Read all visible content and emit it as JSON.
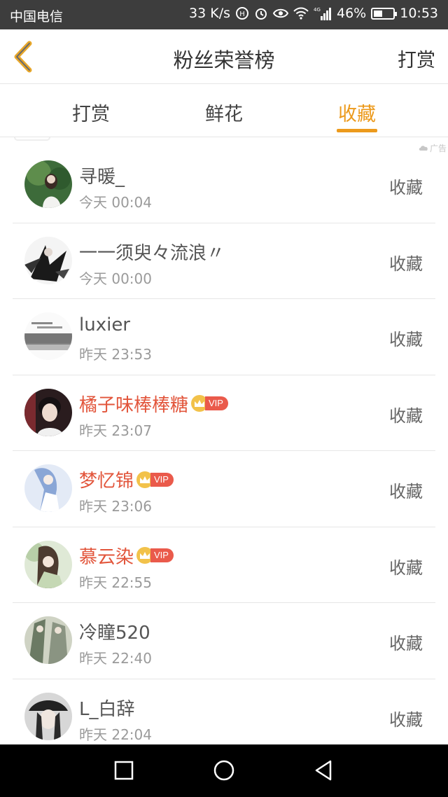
{
  "status_bar": {
    "carrier": "中国电信",
    "speed": "33 K/s",
    "network": "4G",
    "battery": "46%",
    "battery_level": 0.46,
    "time": "10:53"
  },
  "header": {
    "title": "粉丝荣誉榜",
    "action": "打赏"
  },
  "tabs": [
    {
      "label": "打赏",
      "active": false
    },
    {
      "label": "鲜花",
      "active": false
    },
    {
      "label": "收藏",
      "active": true
    }
  ],
  "ad_label": "广告",
  "colors": {
    "accent": "#ec9a1c",
    "vip_name": "#e2553b",
    "vip_badge": "#ea5a4b",
    "crown": "#f2c24a"
  },
  "fans": [
    {
      "name": "寻暖_",
      "time": "今天 00:04",
      "action": "收藏",
      "vip": false,
      "vip_label": ""
    },
    {
      "name": "一一须臾々流浪〃",
      "time": "今天 00:00",
      "action": "收藏",
      "vip": false,
      "vip_label": ""
    },
    {
      "name": "luxier",
      "time": "昨天 23:53",
      "action": "收藏",
      "vip": false,
      "vip_label": ""
    },
    {
      "name": "橘子味棒棒糖",
      "time": "昨天 23:07",
      "action": "收藏",
      "vip": true,
      "vip_label": "VIP"
    },
    {
      "name": "梦忆锦",
      "time": "昨天 23:06",
      "action": "收藏",
      "vip": true,
      "vip_label": "VIP"
    },
    {
      "name": "慕云染",
      "time": "昨天 22:55",
      "action": "收藏",
      "vip": true,
      "vip_label": "VIP"
    },
    {
      "name": "冷瞳520",
      "time": "昨天 22:40",
      "action": "收藏",
      "vip": false,
      "vip_label": ""
    },
    {
      "name": "L_白辞",
      "time": "昨天 22:04",
      "action": "收藏",
      "vip": false,
      "vip_label": ""
    }
  ],
  "nav_icons": [
    "recent-apps-icon",
    "home-icon",
    "back-triangle-icon"
  ]
}
